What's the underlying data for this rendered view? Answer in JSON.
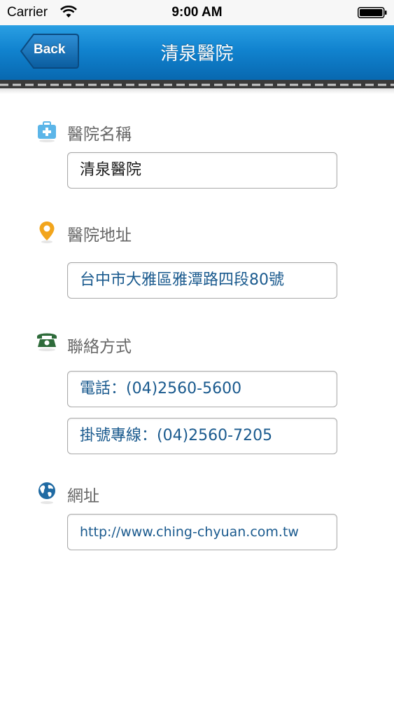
{
  "status_bar": {
    "carrier": "Carrier",
    "time": "9:00 AM"
  },
  "nav": {
    "back_label": "Back",
    "title": "清泉醫院"
  },
  "sections": {
    "name": {
      "label": "醫院名稱",
      "icon": "medical-kit-icon",
      "value": "清泉醫院"
    },
    "address": {
      "label": "醫院地址",
      "icon": "map-pin-icon",
      "value": "台中市大雅區雅潭路四段80號"
    },
    "contact": {
      "label": "聯絡方式",
      "icon": "telephone-icon",
      "phone": "電話：(04)2560-5600",
      "registration": "掛號專線：(04)2560-7205"
    },
    "website": {
      "label": "網址",
      "icon": "globe-icon",
      "value": "http://www.ching-chyuan.com.tw"
    }
  },
  "colors": {
    "nav_blue": "#1183cf",
    "label_gray": "#666666",
    "link_blue": "#1a5a8e",
    "pin_orange": "#f2a51c",
    "phone_green": "#2e6b3a",
    "globe_blue": "#1f6aa3"
  }
}
